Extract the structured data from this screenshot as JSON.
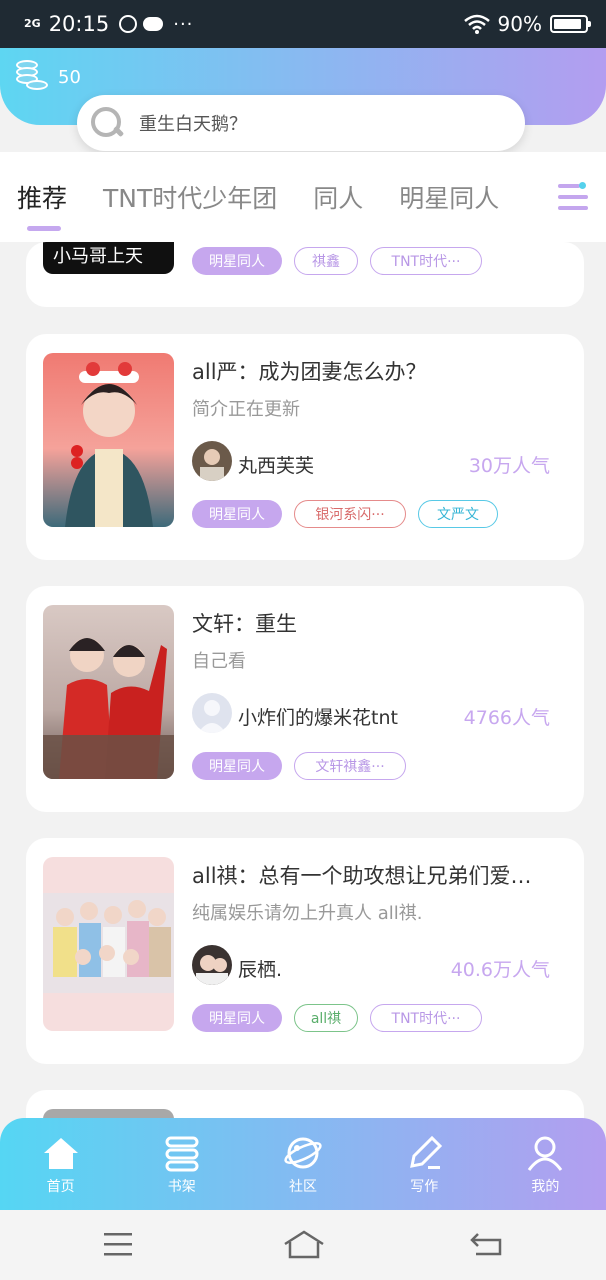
{
  "status_bar": {
    "network": "2G",
    "time": "20:15",
    "dots": "···",
    "battery": "90%"
  },
  "header": {
    "coins": "50",
    "search_placeholder": "重生白天鹅？"
  },
  "tabs": [
    {
      "label": "推荐"
    },
    {
      "label": "TNT时代少年团"
    },
    {
      "label": "同人"
    },
    {
      "label": "明星同人"
    }
  ],
  "cards": [
    {
      "tags": [
        "明星同人",
        "祺鑫",
        "TNT时代···"
      ]
    },
    {
      "title": "all严：成为团妻怎么办？",
      "desc": "简介正在更新",
      "author": "丸西芙芙",
      "popularity": "30万人气",
      "tags": [
        "明星同人",
        "银河系闪···",
        "文严文"
      ]
    },
    {
      "title": "文轩：重生",
      "desc": "自己看",
      "author": "小炸们的爆米花tnt",
      "popularity": "4766人气",
      "tags": [
        "明星同人",
        "文轩祺鑫···"
      ]
    },
    {
      "title": "all祺：总有一个助攻想让兄弟们爱…",
      "desc": "纯属娱乐请勿上升真人 all祺.",
      "author": "辰栖.",
      "popularity": "40.6万人气",
      "tags": [
        "明星同人",
        "all祺",
        "TNT时代···"
      ]
    }
  ],
  "bottom_nav": [
    {
      "label": "首页"
    },
    {
      "label": "书架"
    },
    {
      "label": "社区"
    },
    {
      "label": "写作"
    },
    {
      "label": "我的"
    }
  ],
  "colors": {
    "accent": "#c6a7ee",
    "gradient_start": "#5ed6f2",
    "gradient_end": "#b39df0"
  }
}
